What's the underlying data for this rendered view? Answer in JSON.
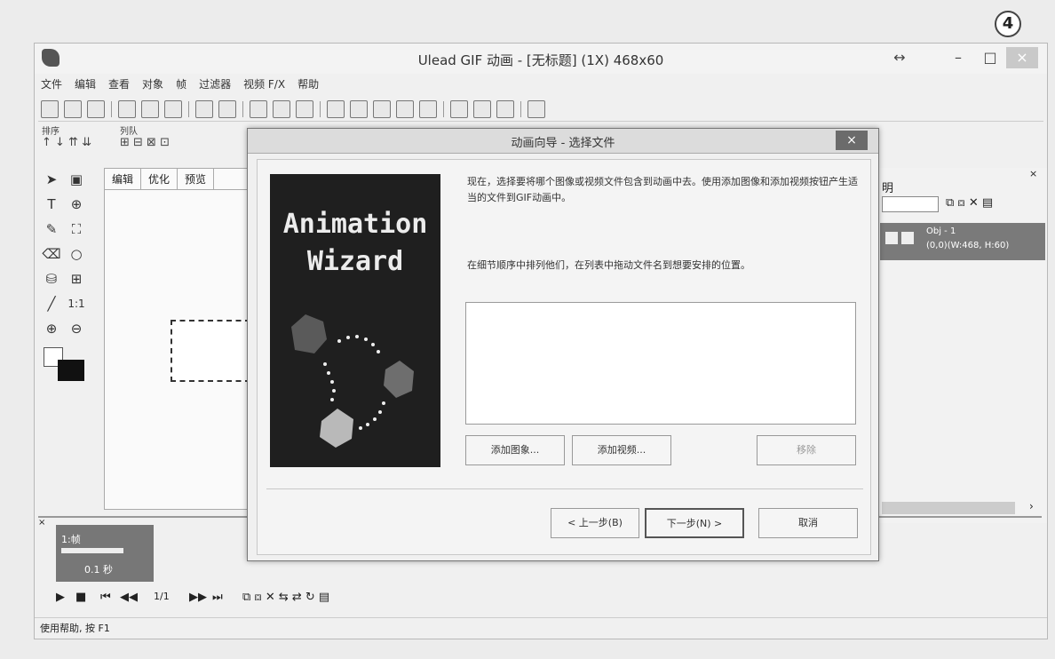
{
  "app": {
    "title": "Ulead GIF 动画 - [无标题] (1X) 468x60",
    "badge": "4",
    "window_buttons": {
      "restore_arrows": "↔",
      "minimize": "–",
      "maximize": "□",
      "close": "×"
    }
  },
  "menu": [
    "文件",
    "编辑",
    "查看",
    "对象",
    "帧",
    "过滤器",
    "视频 F/X",
    "帮助"
  ],
  "arrange_toolbar": {
    "label1": "排序",
    "label2": "列队"
  },
  "toolbox_tools": [
    {
      "icon": "arrow-pointer-icon",
      "glyph": "➤"
    },
    {
      "icon": "marquee-icon",
      "glyph": "▣"
    },
    {
      "icon": "text-icon",
      "glyph": "T"
    },
    {
      "icon": "transform-icon",
      "glyph": "⊕"
    },
    {
      "icon": "brush-icon",
      "glyph": "✎"
    },
    {
      "icon": "crop-icon",
      "glyph": "⛶"
    },
    {
      "icon": "eraser-icon",
      "glyph": "⌫"
    },
    {
      "icon": "lasso-icon",
      "glyph": "○"
    },
    {
      "icon": "fill-icon",
      "glyph": "⛁"
    },
    {
      "icon": "grid-icon",
      "glyph": "⊞"
    },
    {
      "icon": "eyedropper-icon",
      "glyph": "╱"
    },
    {
      "icon": "actual-size-icon",
      "glyph": "1:1"
    },
    {
      "icon": "zoom-in-icon",
      "glyph": "⊕"
    },
    {
      "icon": "zoom-out-icon",
      "glyph": "⊖"
    }
  ],
  "work_tabs": [
    "编辑",
    "优化",
    "预览"
  ],
  "right_panel": {
    "heading": "明",
    "object_name": "Obj - 1",
    "object_info": "(0,0)(W:468, H:60)"
  },
  "frame": {
    "label": "1:帧",
    "delay": "0.1 秒",
    "counter": "1/1"
  },
  "status": "使用帮助, 按 F1",
  "dialog": {
    "title": "动画向导 - 选择文件",
    "close": "×",
    "wizard_line1": "Animation",
    "wizard_line2": "Wizard",
    "desc1": "现在，选择要将哪个图像或视频文件包含到动画中去。使用添加图像和添加视频按钮产生适当的文件到GIF动画中。",
    "desc2": "在细节顺序中排列他们，在列表中拖动文件名到想要安排的位置。",
    "add_image": "添加图象...",
    "add_video": "添加视频...",
    "remove": "移除",
    "back": "< 上一步(B)",
    "next": "下一步(N) >",
    "cancel": "取消"
  }
}
